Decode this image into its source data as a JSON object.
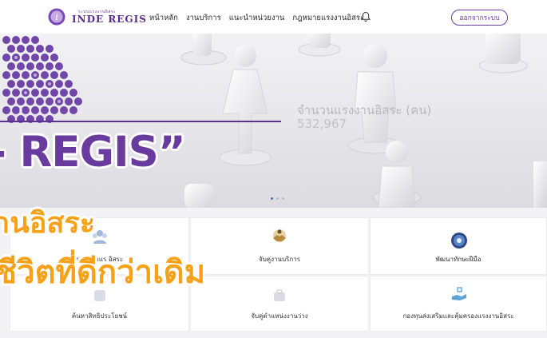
{
  "header": {
    "logo_small": "ระบบแรงงานอิสระ",
    "logo_text": "INDE REGIS",
    "nav": [
      "หน้าหลัก",
      "งานบริการ",
      "แนะนำหน่วยงาน",
      "กฎหมายแรงงานอิสระ"
    ],
    "logout_label": "ออกจากระบบ"
  },
  "hero": {
    "stat_label": "จำนวนแรงงานอิสระ (คน)",
    "stat_value": "532,967",
    "carousel_dots": 3,
    "carousel_active": 1
  },
  "overlay": {
    "headline": "- REGIS”",
    "line1": "านอิสระ",
    "line2": "ชีวิตที่ดีกว่าเดิม"
  },
  "services": [
    {
      "label": "รวมกลุ่มแร   อิสระ",
      "icon": "group-icon"
    },
    {
      "label": "จับคู่งานบริการ",
      "icon": "handshake-icon"
    },
    {
      "label": "พัฒนาทักษะฝีมือ",
      "icon": "skill-badge-icon"
    },
    {
      "label": "ค้นหาสิทธิประโยชน์",
      "icon": "benefit-icon"
    },
    {
      "label": "จับคู่ตำแหน่งงานว่าง",
      "icon": "job-match-icon"
    },
    {
      "label": "กองทุนส่งเสริมและคุ้มครองแรงงานอิสระ",
      "icon": "fund-hand-icon"
    }
  ],
  "colors": {
    "brand_purple": "#5c2e91",
    "accent_orange": "#f6a118",
    "carousel_active": "#4a6fd4"
  }
}
